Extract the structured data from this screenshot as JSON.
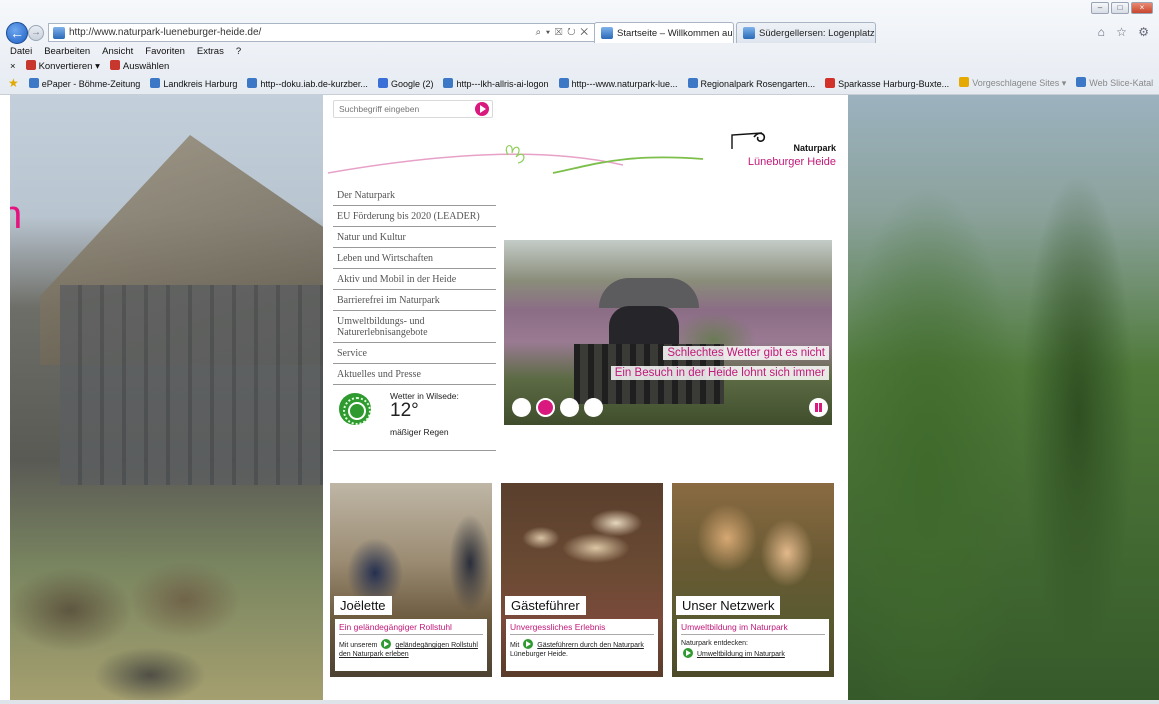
{
  "browser": {
    "url": "http://www.naturpark-lueneburger-heide.de/",
    "addr_tools": "⌕ ▾ ☒ ↻ ✕",
    "tabs": [
      {
        "label": "Startseite – Willkommen au...",
        "active": true
      },
      {
        "label": "Südergellersen: Logenplatz in ...",
        "active": false
      }
    ],
    "menu": [
      "Datei",
      "Bearbeiten",
      "Ansicht",
      "Favoriten",
      "Extras",
      "?"
    ],
    "commands": {
      "close": "×",
      "convert": "Konvertieren",
      "convert_arrow": "▾",
      "select": "Auswählen"
    },
    "favorites": [
      "ePaper - Böhme-Zeitung",
      "Landkreis Harburg",
      "http--doku.iab.de-kurzber...",
      "Google (2)",
      "http---lkh-allris-ai-logon",
      "http---www.naturpark-lue...",
      "Regionalpark Rosengarten...",
      "Sparkasse Harburg-Buxte...",
      "Vorgeschlagene Sites ▾",
      "Web Slice-Katalog ▾"
    ],
    "right_icons": "⌂ ☆ ⚙",
    "window_buttons": {
      "min": "–",
      "max": "□",
      "close": "×"
    }
  },
  "site": {
    "edge_letter": "n",
    "search": {
      "placeholder": "Suchbegriff eingeben"
    },
    "logo": {
      "line1": "Naturpark",
      "line2": "Lüneburger Heide"
    },
    "nav": [
      "Der Naturpark",
      "EU Förderung bis 2020 (LEADER)",
      "Natur und Kultur",
      "Leben und Wirtschaften",
      "Aktiv und Mobil in der Heide",
      "Barrierefrei im Naturpark",
      "Umweltbildungs- und Naturerlebnisangebote",
      "Service",
      "Aktuelles und Presse"
    ],
    "weather": {
      "label": "Wetter in Wilsede:",
      "temp": "12°",
      "desc": "mäßiger Regen"
    },
    "slider": {
      "caption1": "Schlechtes Wetter gibt es nicht",
      "caption2": "Ein Besuch in der Heide lohnt sich immer",
      "slide_count": 4,
      "active_slide": 2
    },
    "teasers": [
      {
        "title": "Joëlette",
        "subtitle": "Ein geländegängiger Rollstuhl",
        "pre": "Mit unserem",
        "link": "geländegängigen Rollstuhl den Naturpark erleben",
        "post": ""
      },
      {
        "title": "Gästeführer",
        "subtitle": "Unvergessliches Erlebnis",
        "pre": "Mit",
        "link": "Gästeführern durch den Naturpark",
        "post": "Lüneburger Heide."
      },
      {
        "title": "Unser Netzwerk",
        "subtitle": "Umweltbildung im Naturpark",
        "pre": "Naturpark entdecken:",
        "link": "Umweltbildung im Naturpark",
        "post": ""
      }
    ]
  },
  "colors": {
    "accent": "#d9197e",
    "brand_text": "#c2187a",
    "weather_icon": "#2e9a2f",
    "nav_text": "#555555"
  }
}
